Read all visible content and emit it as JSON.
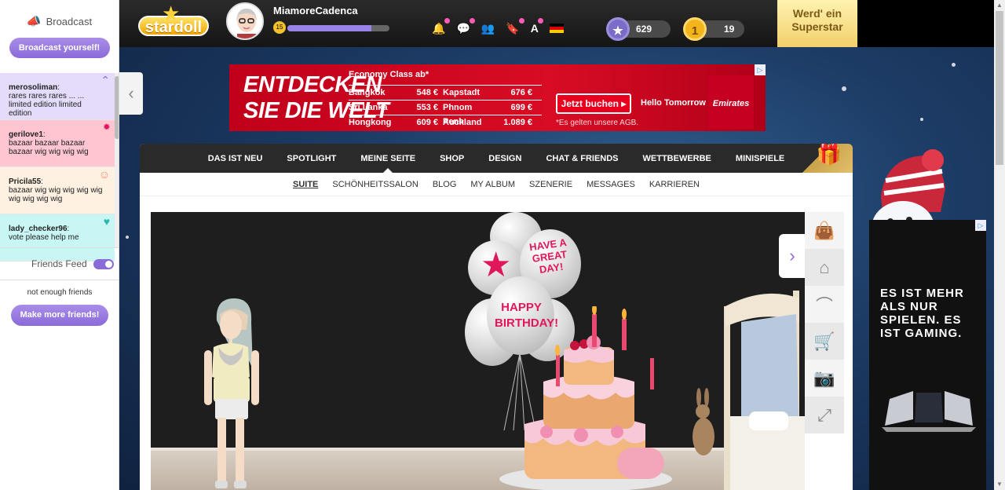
{
  "sidebar": {
    "broadcast_title": "Broadcast",
    "broadcast_button": "Broadcast yourself!",
    "feed": [
      {
        "user": "merosoliman",
        "text": "rares rares rares ... ... limited edition limited edition",
        "bg": "#e4dcfa",
        "icon": "hanger-icon"
      },
      {
        "user": "gerilove1",
        "text": "bazaar bazaar bazaar bazaar wig wig wig wig",
        "bg": "#ffc6d1",
        "icon": "sale-icon"
      },
      {
        "user": "Pricila55",
        "text": "bazaar wig wig wig wig wig wig wig wig wig",
        "bg": "#fff1e2",
        "icon": "face-icon"
      },
      {
        "user": "lady_checker96",
        "text": "vote please help me",
        "bg": "#c8f6f4",
        "icon": "heart-icon"
      }
    ],
    "friends_feed_label": "Friends Feed",
    "friends_feed_enabled": true,
    "no_friends_text": "not enough friends",
    "make_friends_button": "Make more friends!"
  },
  "topbar": {
    "logo": "stardoll",
    "username": "MiamoreCadenca",
    "level": "15",
    "xp_fraction": 0.82,
    "stardollars": "629",
    "coins": "19",
    "superstar_cta": "Werd' ein Superstar",
    "icons": [
      "bell-icon",
      "chat-icon",
      "friends-icon",
      "bookmark-icon",
      "text-icon",
      "flag-de-icon"
    ]
  },
  "ad_banner": {
    "headline_line1": "ENTDECKEN",
    "headline_line2": "SIE DIE WELT",
    "class_label": "Economy Class ab*",
    "fares": [
      {
        "city1": "Bangkok",
        "price1": "548 €",
        "city2": "Kapstadt",
        "price2": "676 €"
      },
      {
        "city1": "Sri Lanka",
        "price1": "553 €",
        "city2": "Phnom Penh",
        "price2": "699 €"
      },
      {
        "city1": "Hongkong",
        "price1": "609 €",
        "city2": "Auckland",
        "price2": "1.089 €"
      }
    ],
    "cta": "Jetzt buchen ▸",
    "tagline": "Hello Tomorrow",
    "footnote": "*Es gelten unsere AGB.",
    "brand": "Emirates"
  },
  "nav": {
    "main": [
      "DAS IST NEU",
      "SPOTLIGHT",
      "MEINE SEITE",
      "SHOP",
      "DESIGN",
      "CHAT & FRIENDS",
      "WETTBEWERBE",
      "MINISPIELE"
    ],
    "main_active": "MEINE SEITE",
    "sub": [
      "SUITE",
      "SCHÖNHEITSSALON",
      "BLOG",
      "MY ALBUM",
      "SZENERIE",
      "MESSAGES",
      "KARRIEREN"
    ],
    "sub_active": "SUITE"
  },
  "room": {
    "balloon_texts": [
      "HAVE A GREAT DAY!",
      "HAPPY BIRTHDAY!"
    ]
  },
  "tools": [
    "shopping-bag-icon",
    "home-icon",
    "hanger-icon",
    "cart-icon",
    "camera-icon",
    "fullscreen-icon"
  ],
  "right_ad": {
    "text": "ES IST MEHR ALS NUR SPIELEN. ES IST GAMING."
  },
  "colors": {
    "accent": "#8b6ad9",
    "ad_red": "#d80c24",
    "nav_dark": "#2a2a2a"
  }
}
